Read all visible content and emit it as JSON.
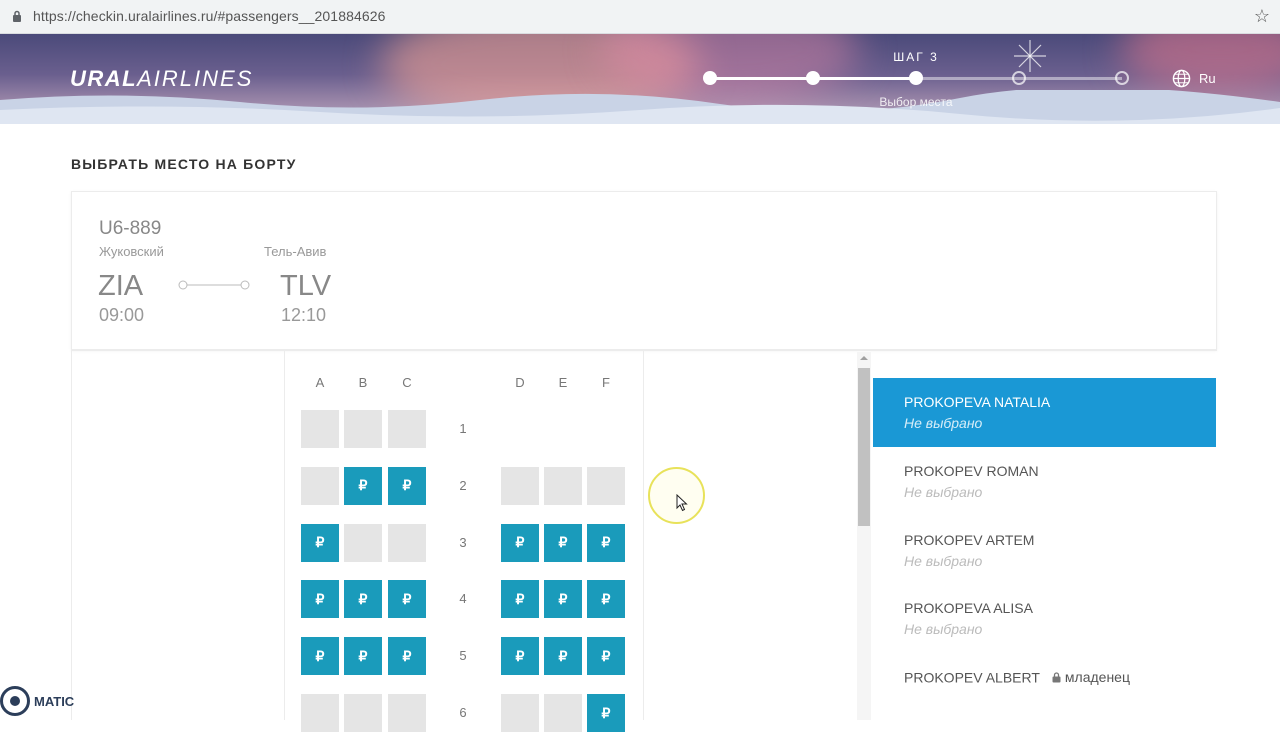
{
  "browser": {
    "url": "https://checkin.uralairlines.ru/#passengers__201884626"
  },
  "header": {
    "logo_bold": "URAL",
    "logo_light": "AIRLINES",
    "step_title": "ШАГ 3",
    "step_subtitle": "Выбор места",
    "current_step": 3,
    "total_steps": 5,
    "language": "Ru"
  },
  "page": {
    "title": "ВЫБРАТЬ МЕСТО НА БОРТУ"
  },
  "flight": {
    "number": "U6-889",
    "from_city": "Жуковский",
    "to_city": "Тель-Авив",
    "from_code": "ZIA",
    "to_code": "TLV",
    "departure": "09:00",
    "arrival": "12:10"
  },
  "seatmap": {
    "columns": [
      "A",
      "B",
      "C",
      "D",
      "E",
      "F"
    ],
    "paid_symbol": "₽",
    "rows": [
      {
        "num": "1",
        "seats": [
          "empty",
          "empty",
          "empty",
          null,
          null,
          null
        ]
      },
      {
        "num": "2",
        "seats": [
          "empty",
          "paid",
          "paid",
          "empty",
          "empty",
          "empty"
        ]
      },
      {
        "num": "3",
        "seats": [
          "paid",
          "empty",
          "empty",
          "paid",
          "paid",
          "paid"
        ]
      },
      {
        "num": "4",
        "seats": [
          "paid",
          "paid",
          "paid",
          "paid",
          "paid",
          "paid"
        ]
      },
      {
        "num": "5",
        "seats": [
          "paid",
          "paid",
          "paid",
          "paid",
          "paid",
          "paid"
        ]
      },
      {
        "num": "6",
        "seats": [
          "empty",
          "empty",
          "empty",
          "empty",
          "empty",
          "paid"
        ]
      }
    ]
  },
  "passengers": [
    {
      "name": "PROKOPEVA NATALIA",
      "status": "Не выбрано",
      "active": true
    },
    {
      "name": "PROKOPEV ROMAN",
      "status": "Не выбрано",
      "active": false
    },
    {
      "name": "PROKOPEV ARTEM",
      "status": "Не выбрано",
      "active": false
    },
    {
      "name": "PROKOPEVA ALISA",
      "status": "Не выбрано",
      "active": false
    },
    {
      "name": "PROKOPEV ALBERT",
      "infant_label": "младенец",
      "active": false
    }
  ],
  "watermark": {
    "text": "MATIC"
  },
  "colors": {
    "accent": "#1a98d5",
    "paid_seat": "#1a9bbb",
    "empty_seat": "#e5e5e5"
  }
}
